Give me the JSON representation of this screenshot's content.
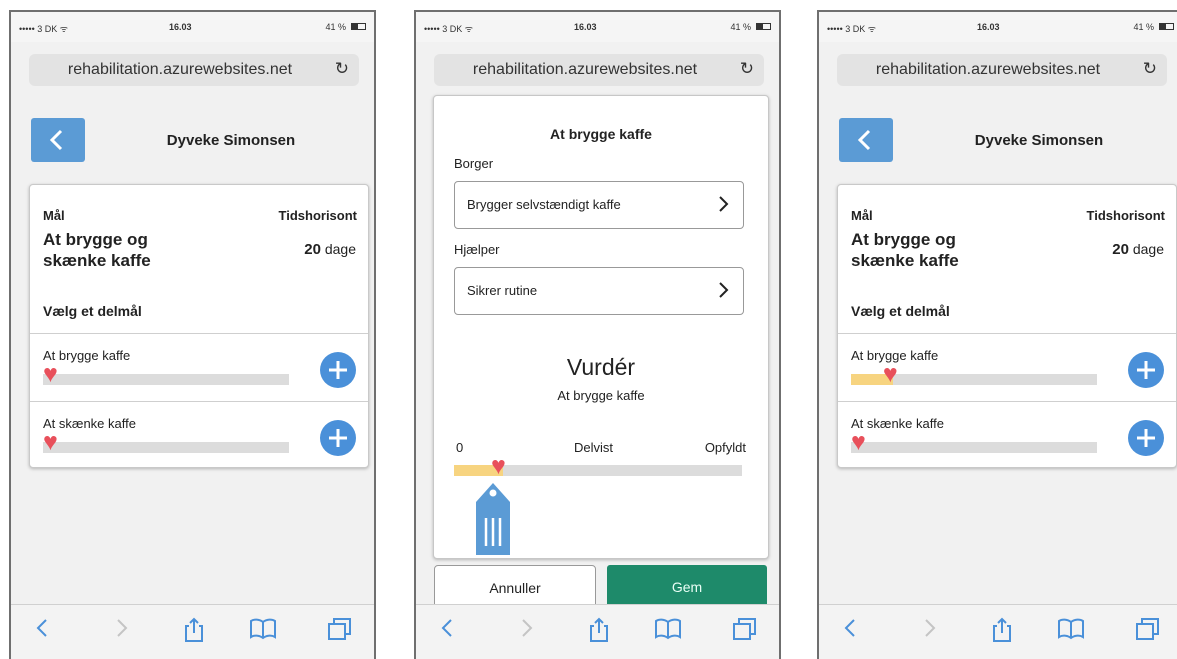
{
  "status_bar": {
    "carrier": "••••• 3 DK ᯤ",
    "time": "16.03",
    "battery": "41 %"
  },
  "url": "rehabilitation.azurewebsites.net",
  "colors": {
    "accent": "#4a90d9",
    "save": "#1e8a6a",
    "heart": "#e8505b",
    "progress": "#f7d480"
  },
  "screen1": {
    "title": "Dyveke Simonsen",
    "goal_label": "Mål",
    "horizon_label": "Tidshorisont",
    "goal": "At brygge og skænke kaffe",
    "days_value": "20",
    "days_unit": "dage",
    "choose_subgoal": "Vælg et delmål",
    "subgoals": [
      {
        "label": "At brygge kaffe",
        "progress": 0
      },
      {
        "label": "At skænke kaffe",
        "progress": 0
      }
    ]
  },
  "screen2": {
    "title": "At brygge kaffe",
    "citizen_label": "Borger",
    "citizen_value": "Brygger selvstændigt kaffe",
    "helper_label": "Hjælper",
    "helper_value": "Sikrer rutine",
    "assess_title": "Vurdér",
    "assess_subtitle": "At brygge kaffe",
    "scale": {
      "low": "0",
      "mid": "Delvist",
      "high": "Opfyldt"
    },
    "current_progress": 0.17,
    "cancel_label": "Annuller",
    "save_label": "Gem"
  },
  "screen3": {
    "title": "Dyveke Simonsen",
    "goal_label": "Mål",
    "horizon_label": "Tidshorisont",
    "goal": "At brygge og skænke kaffe",
    "days_value": "20",
    "days_unit": "dage",
    "choose_subgoal": "Vælg et delmål",
    "subgoals": [
      {
        "label": "At brygge kaffe",
        "progress": 0.17
      },
      {
        "label": "At skænke kaffe",
        "progress": 0
      }
    ]
  },
  "toolbar_icons": [
    "back-icon",
    "forward-icon",
    "share-icon",
    "bookmarks-icon",
    "tabs-icon"
  ]
}
